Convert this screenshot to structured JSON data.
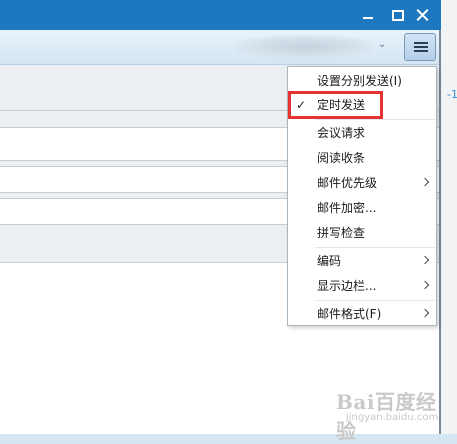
{
  "window": {
    "controls": {
      "minimize_icon": "minimize-icon",
      "maximize_icon": "maximize-icon",
      "close_icon": "close-icon"
    }
  },
  "toolbar": {
    "dropdown_icon": "chevron-down-icon",
    "menu_icon": "menu-lines-icon"
  },
  "side_digit": "-1",
  "menu": {
    "items": [
      {
        "label": "设置分别发送(I)",
        "checked": false,
        "submenu": false
      },
      {
        "label": "定时发送",
        "checked": true,
        "submenu": false
      },
      {
        "label": "会议请求",
        "checked": false,
        "submenu": false
      },
      {
        "label": "阅读收条",
        "checked": false,
        "submenu": false
      },
      {
        "label": "邮件优先级",
        "checked": false,
        "submenu": true
      },
      {
        "label": "邮件加密...",
        "checked": false,
        "submenu": false
      },
      {
        "label": "拼写检查",
        "checked": false,
        "submenu": false
      },
      {
        "label": "编码",
        "checked": false,
        "submenu": true
      },
      {
        "label": "显示边栏...",
        "checked": false,
        "submenu": true
      },
      {
        "label": "邮件格式(F)",
        "checked": false,
        "submenu": true
      }
    ],
    "check_mark": "✓"
  },
  "watermark": {
    "main": "Bai百度经验",
    "sub": "jingyan.baidu.com"
  },
  "colors": {
    "titlebar": "#1e78c0",
    "highlight": "#e53333",
    "menu_border": "#a9b6c2"
  }
}
